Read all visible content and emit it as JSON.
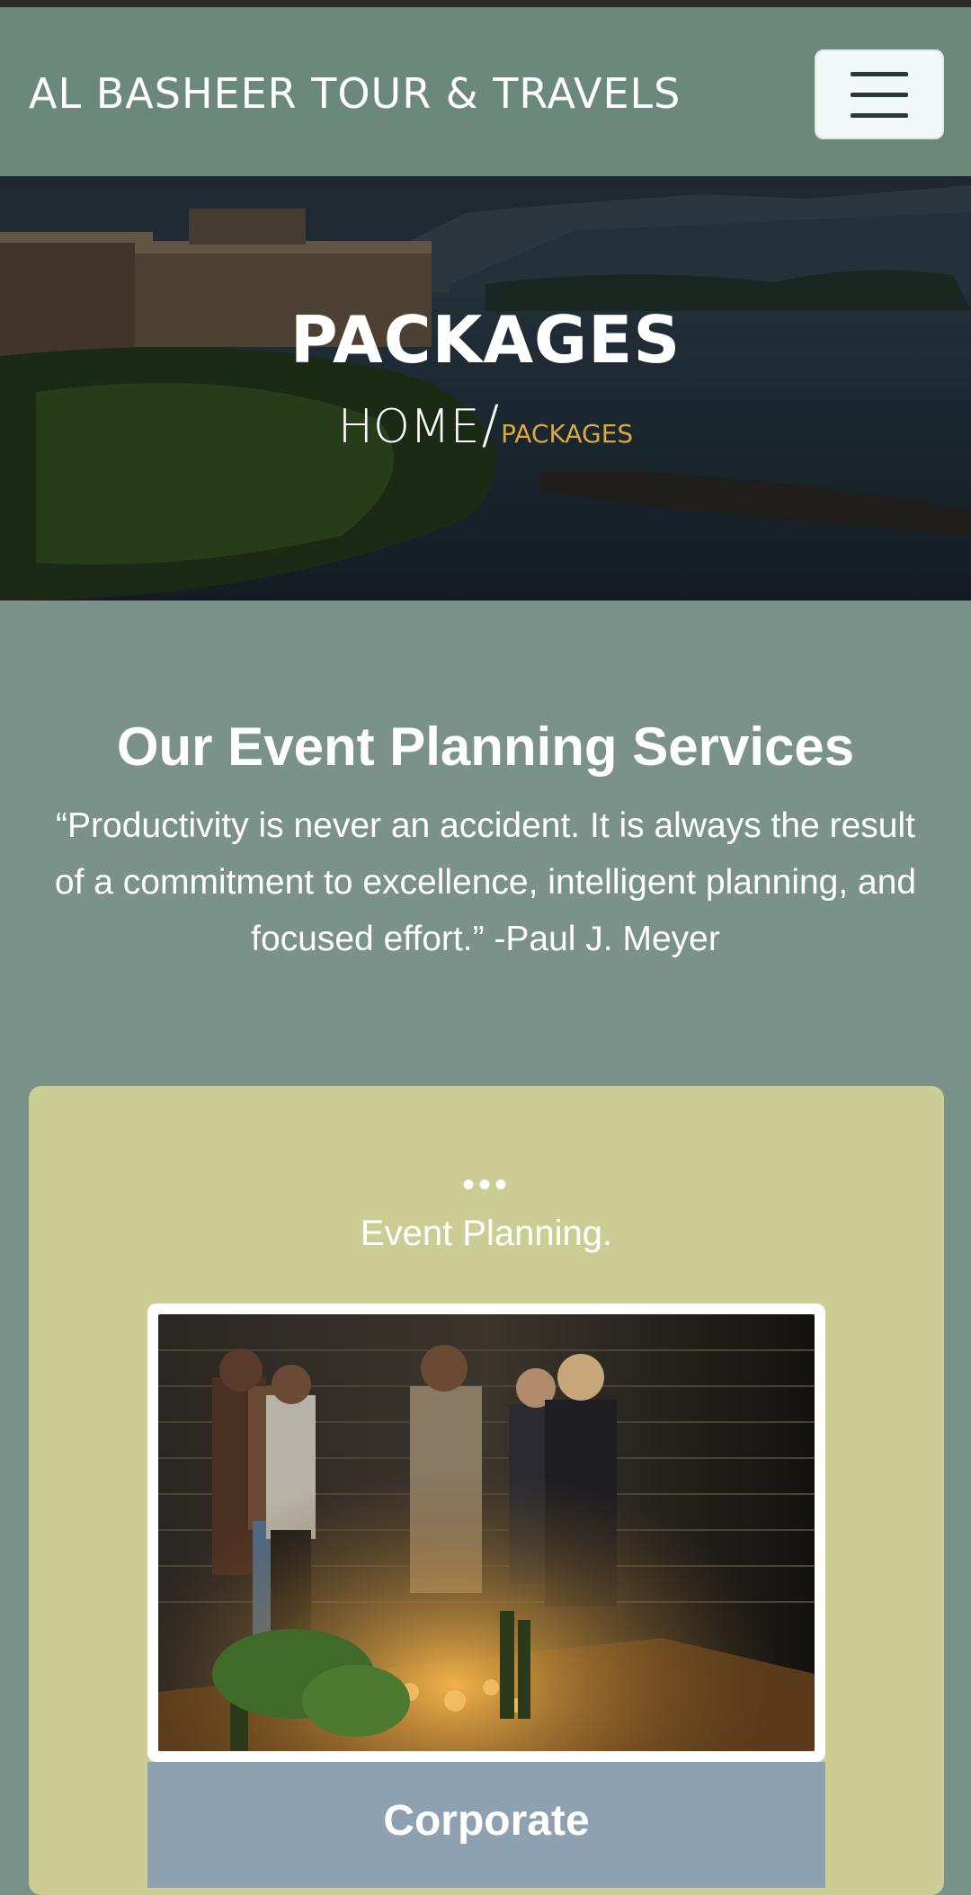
{
  "navbar": {
    "brand": "AL BASHEER TOUR & TRAVELS",
    "menu_icon": "hamburger-menu-icon"
  },
  "hero": {
    "title": "PACKAGES",
    "breadcrumb": {
      "home": "HOME",
      "separator": "/",
      "current": "PACKAGES"
    }
  },
  "services": {
    "title": "Our Event Planning Services",
    "quote": "“Productivity is never an accident. It is always the result of a commitment to excellence, intelligent planning, and focused effort.” -Paul J. Meyer"
  },
  "card": {
    "dots": "•••",
    "heading": "Event Planning.",
    "caption": "Corporate"
  },
  "colors": {
    "navbar": "#6b897b",
    "page_bg": "#7a928a",
    "card_bg": "#cccd95",
    "caption_bg": "#8ea1b0",
    "breadcrumb_accent": "#d9a93a"
  }
}
